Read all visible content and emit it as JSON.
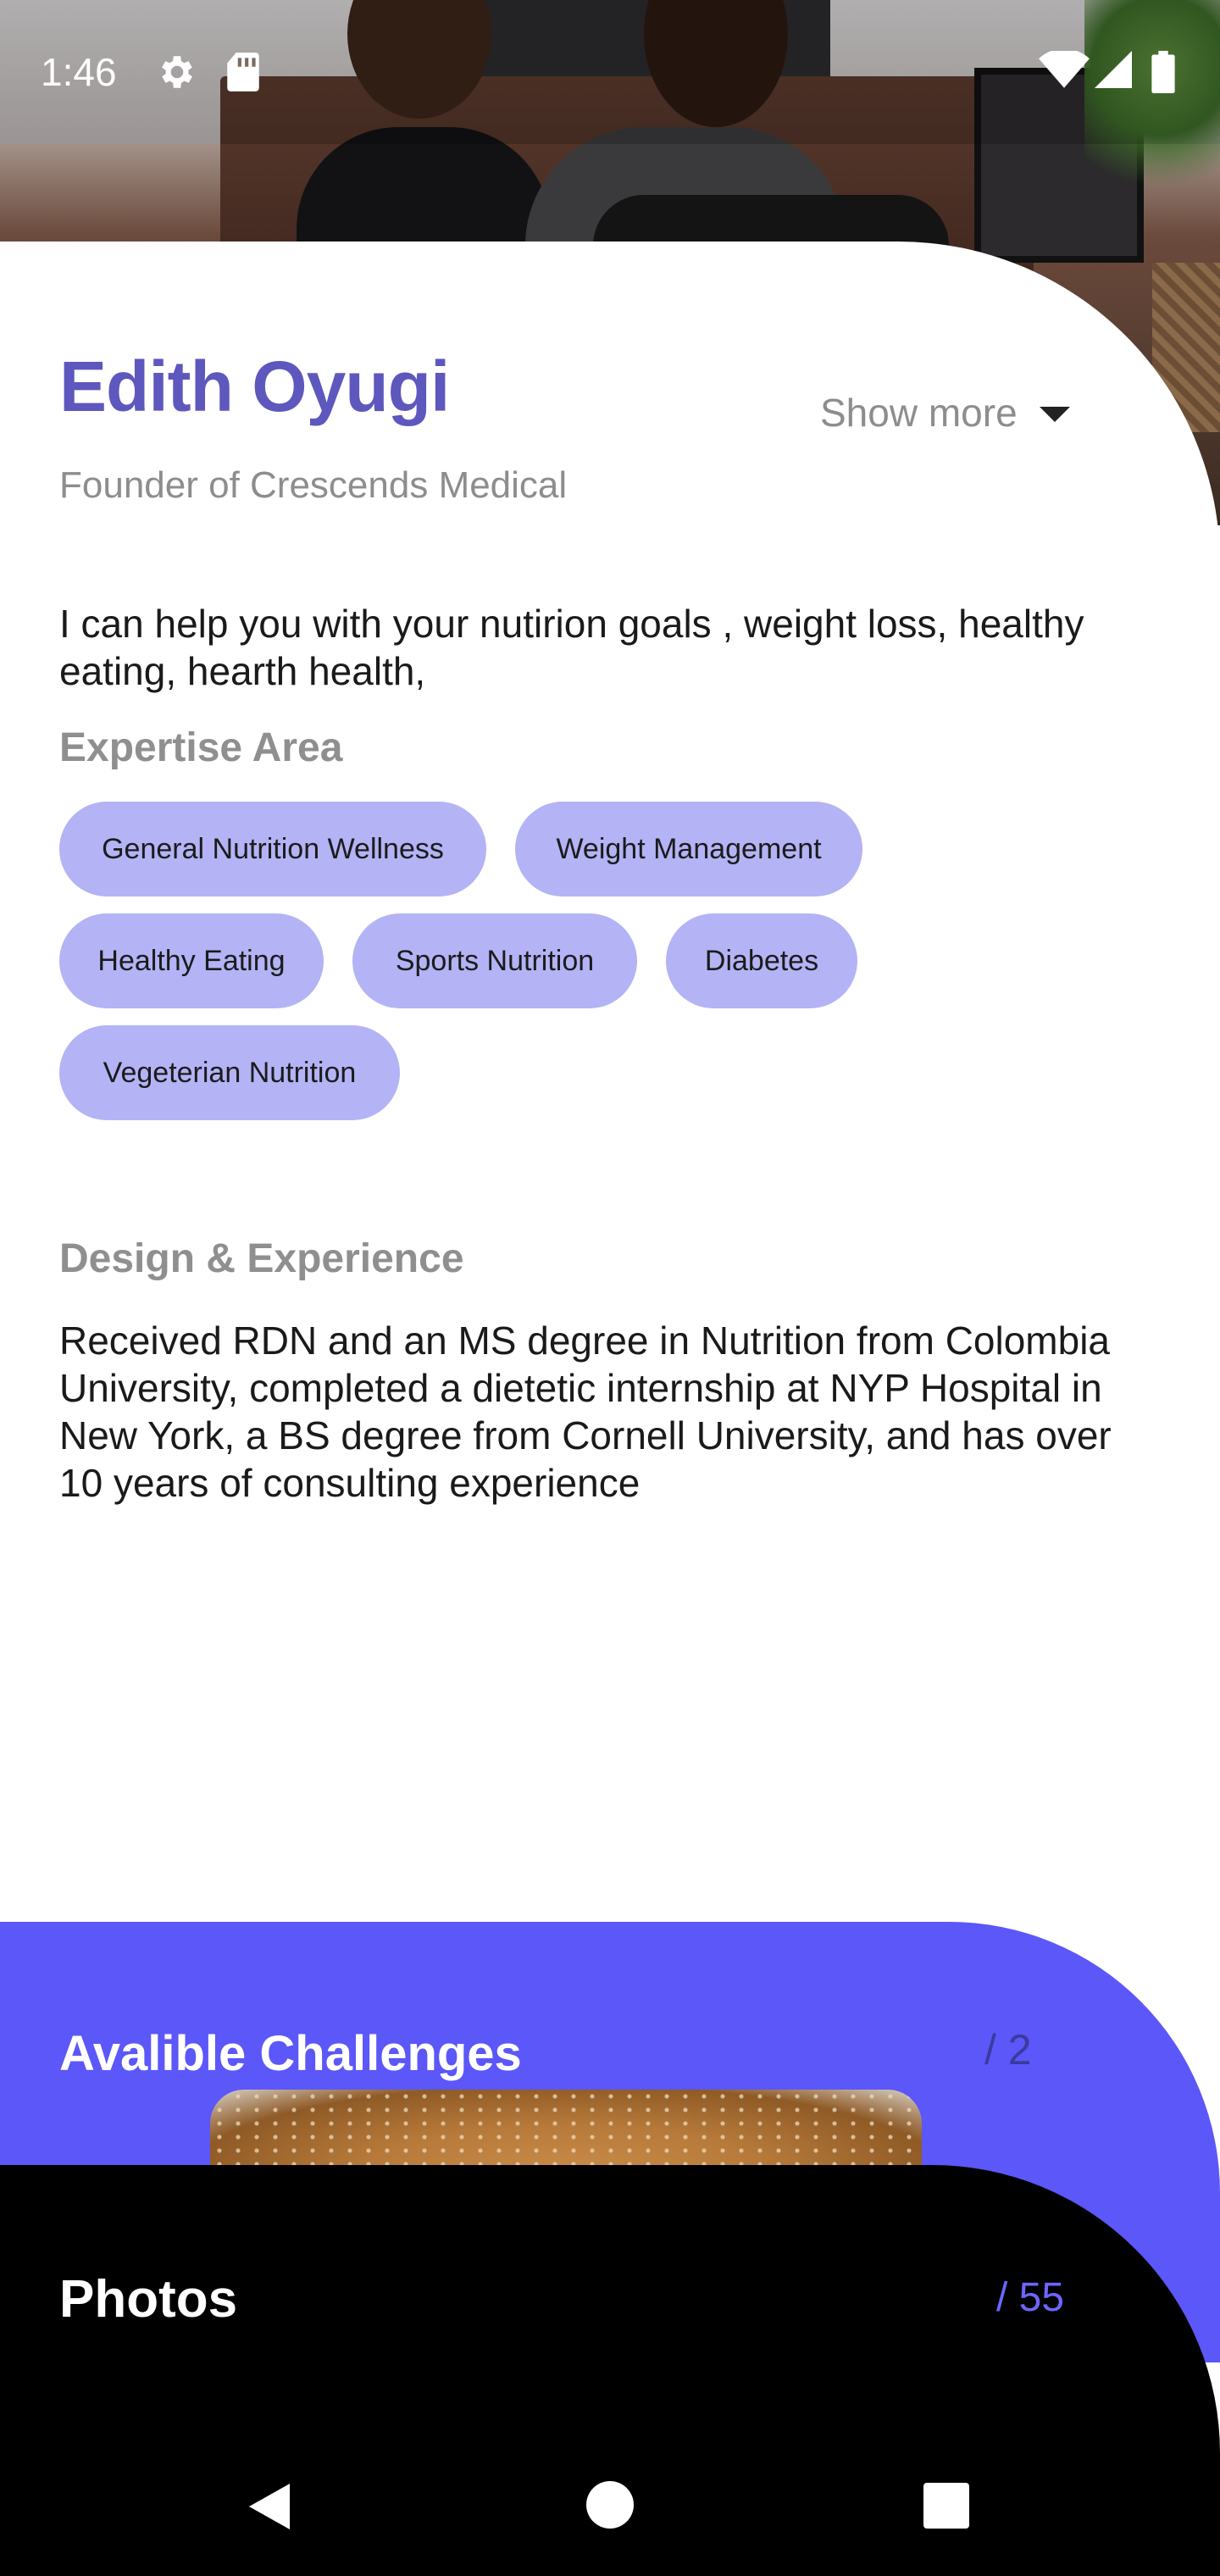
{
  "status_bar": {
    "time": "1:46",
    "icons": [
      "gear-icon",
      "sd-card-icon",
      "wifi-icon",
      "signal-icon",
      "battery-icon"
    ]
  },
  "profile": {
    "name": "Edith Oyugi",
    "subtitle": "Founder of Crescends Medical",
    "show_more_label": "Show more",
    "intro": "I can help you with your nutirion goals , weight loss, healthy eating, hearth health,"
  },
  "expertise": {
    "title": "Expertise Area",
    "chips": [
      "General Nutrition Wellness",
      "Weight Management",
      "Healthy Eating",
      "Sports Nutrition",
      "Diabetes",
      "Vegeterian Nutrition"
    ]
  },
  "experience": {
    "title": "Design & Experience",
    "text": "Received RDN and an MS degree in Nutrition from Colombia University, completed a dietetic internship at NYP Hospital in New York, a BS degree from Cornell University, and has over 10 years of consulting experience"
  },
  "challenges": {
    "title": "Avalible Challenges",
    "count": "/ 2"
  },
  "photos": {
    "title": "Photos",
    "count": "/ 55"
  },
  "nav_bar": {
    "buttons": [
      "back-icon",
      "home-icon",
      "recents-icon"
    ]
  },
  "colors": {
    "accent_purple": "#5e57bd",
    "chip_bg": "#b3b3f6",
    "challenges_bg": "#5b57f8",
    "photos_bg": "#000000",
    "muted_text": "#8d8d8d"
  }
}
